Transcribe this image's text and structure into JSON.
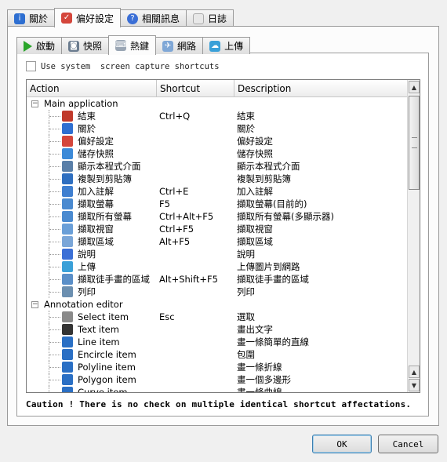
{
  "tabs": [
    {
      "label": "關於",
      "icon": "info-icon",
      "active": false
    },
    {
      "label": "偏好設定",
      "icon": "preferences-icon",
      "active": true
    },
    {
      "label": "相關訊息",
      "icon": "help-icon",
      "active": false
    },
    {
      "label": "日誌",
      "icon": "log-icon",
      "active": false
    }
  ],
  "subtabs": [
    {
      "label": "啟動",
      "icon": "play-icon",
      "active": false
    },
    {
      "label": "快照",
      "icon": "camera-icon",
      "active": false
    },
    {
      "label": "熱鍵",
      "icon": "hotkey-icon",
      "active": true
    },
    {
      "label": "網路",
      "icon": "network-icon",
      "active": false
    },
    {
      "label": "上傳",
      "icon": "upload-icon",
      "active": false
    }
  ],
  "use_system_shortcuts": {
    "label": "Use system  screen capture shortcuts",
    "checked": false
  },
  "columns": {
    "action": "Action",
    "shortcut": "Shortcut",
    "description": "Description"
  },
  "rows": [
    {
      "type": "group",
      "name": "Main application",
      "expanded": true
    },
    {
      "type": "item",
      "name": "結束",
      "shortcut": "Ctrl+Q",
      "description": "結束",
      "icon": "quit-icon",
      "color": "#c0392b"
    },
    {
      "type": "item",
      "name": "關於",
      "shortcut": "",
      "description": "關於",
      "icon": "info-icon",
      "color": "#2e6fd1"
    },
    {
      "type": "item",
      "name": "偏好設定",
      "shortcut": "",
      "description": "偏好設定",
      "icon": "preferences-icon",
      "color": "#d4463b"
    },
    {
      "type": "item",
      "name": "儲存快照",
      "shortcut": "",
      "description": "儲存快照",
      "icon": "save-icon",
      "color": "#3c8ad8"
    },
    {
      "type": "item",
      "name": "顯示本程式介面",
      "shortcut": "",
      "description": "顯示本程式介面",
      "icon": "show-window-icon",
      "color": "#5a7fa8"
    },
    {
      "type": "item",
      "name": "複製到剪貼簿",
      "shortcut": "",
      "description": "複製到剪貼簿",
      "icon": "clipboard-icon",
      "color": "#2f6fc0"
    },
    {
      "type": "item",
      "name": "加入註解",
      "shortcut": "Ctrl+E",
      "description": "加入註解",
      "icon": "pencil-icon",
      "color": "#3f7fd0"
    },
    {
      "type": "item",
      "name": "擷取螢幕",
      "shortcut": "F5",
      "description": "擷取螢幕(目前的)",
      "icon": "monitor-icon",
      "color": "#4a8ad0"
    },
    {
      "type": "item",
      "name": "擷取所有螢幕",
      "shortcut": "Ctrl+Alt+F5",
      "description": "擷取所有螢幕(多顯示器)",
      "icon": "monitors-icon",
      "color": "#4a8ad0"
    },
    {
      "type": "item",
      "name": "擷取視窗",
      "shortcut": "Ctrl+F5",
      "description": "擷取視窗",
      "icon": "window-icon",
      "color": "#6a9fd8"
    },
    {
      "type": "item",
      "name": "擷取區域",
      "shortcut": "Alt+F5",
      "description": "擷取區域",
      "icon": "region-icon",
      "color": "#7aa6d8"
    },
    {
      "type": "item",
      "name": "說明",
      "shortcut": "",
      "description": "說明",
      "icon": "help-icon",
      "color": "#3b6fd6"
    },
    {
      "type": "item",
      "name": "上傳",
      "shortcut": "",
      "description": "上傳圖片到網路",
      "icon": "upload-icon",
      "color": "#3aa0d8"
    },
    {
      "type": "item",
      "name": "擷取徒手畫的區域",
      "shortcut": "Alt+Shift+F5",
      "description": "擷取徒手畫的區域",
      "icon": "freehand-icon",
      "color": "#5a8fc8"
    },
    {
      "type": "item",
      "name": "列印",
      "shortcut": "",
      "description": "列印",
      "icon": "printer-icon",
      "color": "#6b8fb0"
    },
    {
      "type": "group",
      "name": "Annotation editor",
      "expanded": true
    },
    {
      "type": "item",
      "name": "Select item",
      "shortcut": "Esc",
      "description": "選取",
      "icon": "cursor-icon",
      "color": "#8a8a8a"
    },
    {
      "type": "item",
      "name": "Text item",
      "shortcut": "",
      "description": "畫出文字",
      "icon": "text-icon",
      "color": "#333333"
    },
    {
      "type": "item",
      "name": "Line item",
      "shortcut": "",
      "description": "畫一條簡單的直線",
      "icon": "line-icon",
      "color": "#2a6fc4"
    },
    {
      "type": "item",
      "name": "Encircle item",
      "shortcut": "",
      "description": "包圍",
      "icon": "ellipse-icon",
      "color": "#2a6fc4"
    },
    {
      "type": "item",
      "name": "Polyline item",
      "shortcut": "",
      "description": "畫一條折線",
      "icon": "polyline-icon",
      "color": "#2a6fc4"
    },
    {
      "type": "item",
      "name": "Polygon item",
      "shortcut": "",
      "description": "畫一個多邊形",
      "icon": "polygon-icon",
      "color": "#2a6fc4"
    },
    {
      "type": "item",
      "name": "Curve item",
      "shortcut": "",
      "description": "畫一條曲線",
      "icon": "curve-icon",
      "color": "#2a6fc4"
    }
  ],
  "caution": "Caution ! There is no check on multiple identical shortcut affectations.",
  "buttons": {
    "ok": "OK",
    "cancel": "Cancel"
  }
}
